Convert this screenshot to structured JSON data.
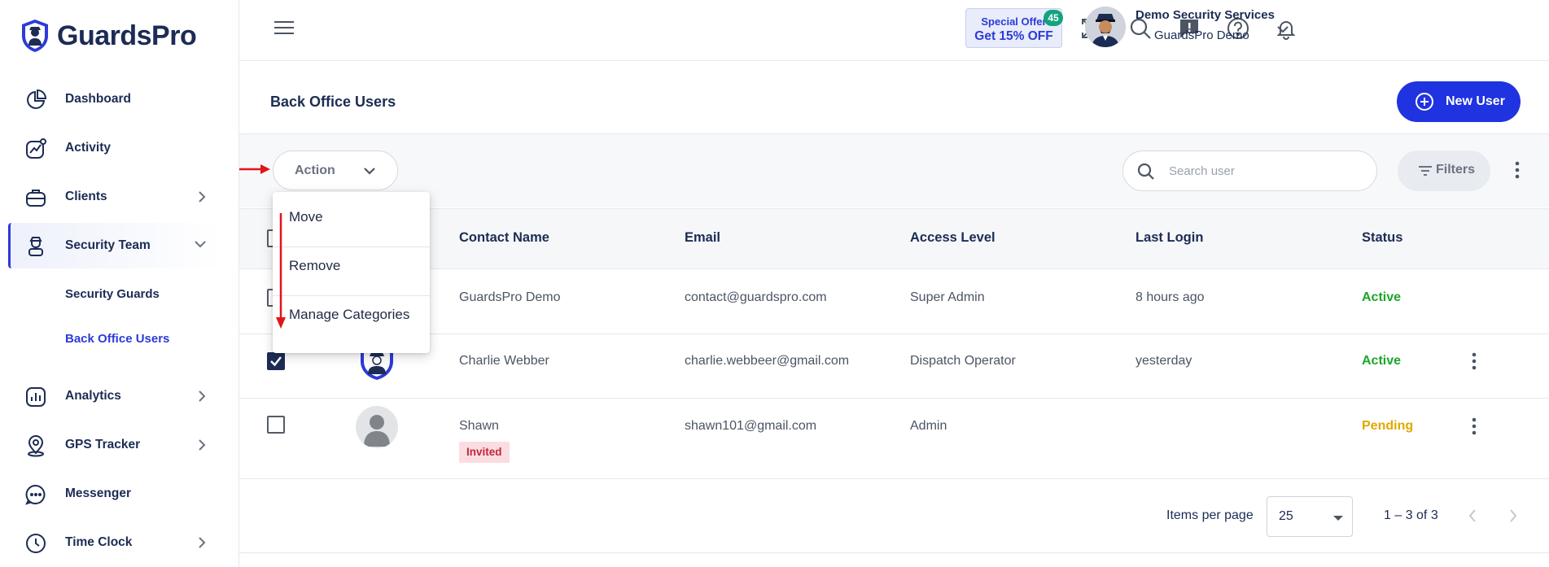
{
  "brand": {
    "name": "GuardsPro"
  },
  "sidebar": {
    "items": [
      {
        "label": "Dashboard",
        "icon": "pie-chart-icon",
        "has_chevron": false
      },
      {
        "label": "Activity",
        "icon": "activity-chart-icon",
        "has_chevron": false
      },
      {
        "label": "Clients",
        "icon": "briefcase-icon",
        "has_chevron": true
      },
      {
        "label": "Security Team",
        "icon": "guard-icon",
        "has_chevron": true,
        "expanded": true
      },
      {
        "label": "Analytics",
        "icon": "bar-chart-icon",
        "has_chevron": true
      },
      {
        "label": "GPS Tracker",
        "icon": "location-pin-icon",
        "has_chevron": true
      },
      {
        "label": "Messenger",
        "icon": "chat-bubble-icon",
        "has_chevron": false
      },
      {
        "label": "Time Clock",
        "icon": "clock-icon",
        "has_chevron": true
      }
    ],
    "subitems": [
      {
        "label": "Security Guards",
        "active": false
      },
      {
        "label": "Back Office Users",
        "active": true
      }
    ]
  },
  "topbar": {
    "offer_line1": "Special Offer",
    "offer_line2": "Get 15% OFF",
    "notification_count": "45",
    "user_name": "Demo Security Services",
    "user_org": "GuardsPro Demo"
  },
  "page": {
    "title": "Back Office Users",
    "new_user_label": "New User"
  },
  "toolbar": {
    "action_label": "Action",
    "search_placeholder": "Search user",
    "filters_label": "Filters"
  },
  "action_menu": {
    "items": [
      "Move",
      "Remove",
      "Manage Categories"
    ]
  },
  "table": {
    "columns": [
      "Contact Name",
      "Email",
      "Access Level",
      "Last Login",
      "Status"
    ],
    "rows": [
      {
        "name": "GuardsPro Demo",
        "email": "contact@guardspro.com",
        "access": "Super Admin",
        "last_login": "8 hours ago",
        "status": "Active",
        "checked": false,
        "tag": ""
      },
      {
        "name": "Charlie Webber",
        "email": "charlie.webbeer@gmail.com",
        "access": "Dispatch Operator",
        "last_login": "yesterday",
        "status": "Active",
        "checked": true,
        "tag": ""
      },
      {
        "name": "Shawn",
        "email": "shawn101@gmail.com",
        "access": "Admin",
        "last_login": "",
        "status": "Pending",
        "checked": false,
        "tag": "Invited"
      }
    ]
  },
  "pagination": {
    "items_per_page_label": "Items per page",
    "items_per_page": "25",
    "range": "1 – 3 of 3"
  },
  "colors": {
    "accent": "#1f33e0",
    "navy": "#1c2c54",
    "active_status": "#1aa62a",
    "pending_status": "#e0a800",
    "badge": "#14a37f",
    "annotation_arrow": "#e0151b"
  }
}
